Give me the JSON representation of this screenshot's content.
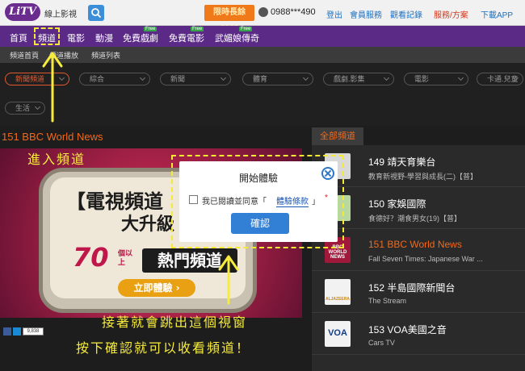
{
  "header": {
    "logo_text": "LiTV",
    "brand_sub": "線上影視",
    "promo_label": "限時長餘 $168",
    "phone": "0988***490",
    "links": [
      "登出",
      "會員服務",
      "觀看記錄",
      "服務/方案",
      "下載APP"
    ]
  },
  "nav": {
    "items": [
      "首頁",
      "頻道",
      "電影",
      "動漫",
      "免費戲劇",
      "免費電影",
      "武媚娘傳奇"
    ],
    "free_tag": "Free",
    "active_index": 1
  },
  "subnav": {
    "items": [
      "頻道首頁",
      "頻道播放",
      "頻道列表"
    ]
  },
  "filters": {
    "items": [
      "新聞頻道",
      "綜合",
      "新聞",
      "體育",
      "戲劇.影集",
      "電影",
      "卡通.兒童",
      "生活"
    ]
  },
  "player": {
    "channel_title": "151  BBC World News",
    "promo_line1": "【電視頻道",
    "promo_line2": "大升級",
    "promo_number": "70",
    "promo_number_sub": "個以上",
    "promo_hot": "熱門頻道",
    "promo_cta": "立即體驗 ›",
    "like_count": "9,838"
  },
  "channel_list": {
    "header": "全部頻道",
    "rows": [
      {
        "number_name": "149  靖天育樂台",
        "program": "教育新視野-學習與成長(二)【普】"
      },
      {
        "number_name": "150  家娛國際",
        "program": "食德好？潮食男女(19)【普】"
      },
      {
        "number_name": "151  BBC World News",
        "program": "Fall Seven Times: Japanese War ..."
      },
      {
        "number_name": "152  半島國際新聞台",
        "program": "The Stream"
      },
      {
        "number_name": "153  VOA美國之音",
        "program": "Cars TV"
      }
    ],
    "current_index": 2,
    "logos": [
      "",
      "",
      "BBC WORLD NEWS",
      "ALJAZEERA",
      "VOA"
    ]
  },
  "modal": {
    "title": "開始體驗",
    "agree_text": "我已閱讀並同意「",
    "terms_link": "體驗條款",
    "quote_close": "」",
    "required_mark": "*",
    "confirm_label": "確認"
  },
  "annotations": {
    "enter_channel": "進入頻道",
    "note_line1": "接著就會跳出這個視窗",
    "note_line2": "按下確認就可以收看頻道！"
  },
  "colors": {
    "nav_bg": "#5a2a86",
    "accent_orange": "#ef6a1e",
    "annotation_yellow": "#f7ec3c",
    "confirm_blue": "#3180d6"
  }
}
